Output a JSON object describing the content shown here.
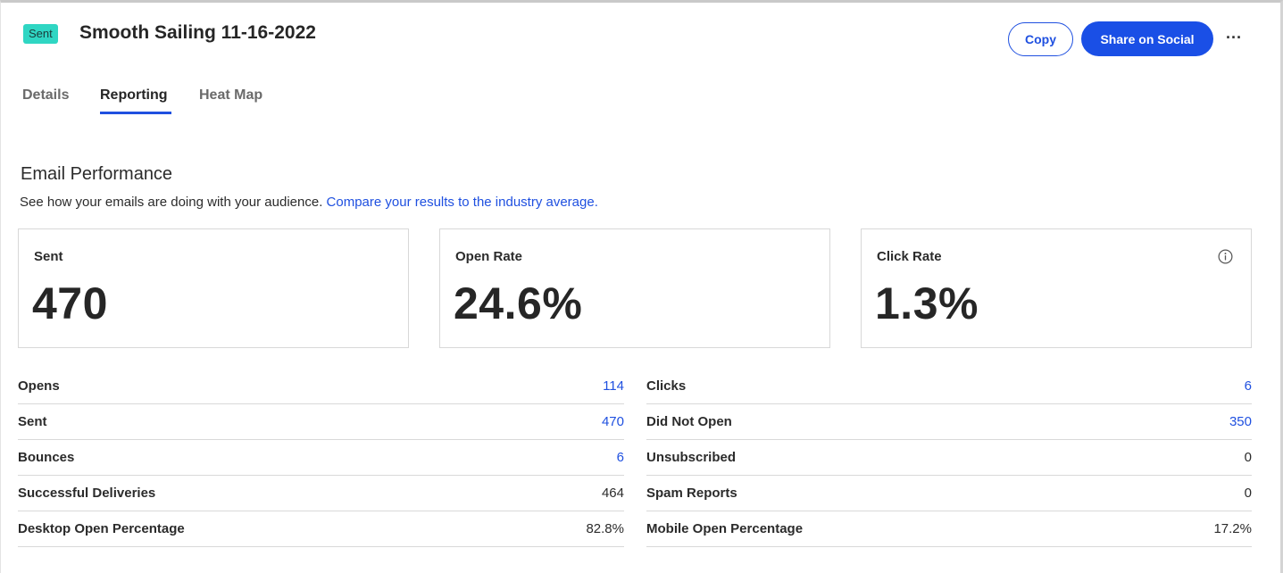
{
  "header": {
    "status_badge": "Sent",
    "title": "Smooth Sailing 11-16-2022",
    "copy_label": "Copy",
    "share_label": "Share on Social",
    "more_label": "···"
  },
  "tabs": [
    {
      "label": "Details",
      "active": false
    },
    {
      "label": "Reporting",
      "active": true
    },
    {
      "label": "Heat Map",
      "active": false
    }
  ],
  "section": {
    "title": "Email Performance",
    "subtitle": "See how your emails are doing with your audience.",
    "link": "Compare your results to the industry average."
  },
  "cards": [
    {
      "label": "Sent",
      "value": "470"
    },
    {
      "label": "Open Rate",
      "value": "24.6%"
    },
    {
      "label": "Click Rate",
      "value": "1.3%",
      "icon": "info-icon"
    }
  ],
  "metrics_left": [
    {
      "label": "Opens",
      "value": "114",
      "link": true
    },
    {
      "label": "Sent",
      "value": "470",
      "link": true
    },
    {
      "label": "Bounces",
      "value": "6",
      "link": true
    },
    {
      "label": "Successful Deliveries",
      "value": "464",
      "link": false
    },
    {
      "label": "Desktop Open Percentage",
      "value": "82.8%",
      "link": false
    }
  ],
  "metrics_right": [
    {
      "label": "Clicks",
      "value": "6",
      "link": true
    },
    {
      "label": "Did Not Open",
      "value": "350",
      "link": true
    },
    {
      "label": "Unsubscribed",
      "value": "0",
      "link": false
    },
    {
      "label": "Spam Reports",
      "value": "0",
      "link": false
    },
    {
      "label": "Mobile Open Percentage",
      "value": "17.2%",
      "link": false
    }
  ],
  "colors": {
    "badge": "#2fd6c3",
    "accent": "#1f50e0",
    "primary_button": "#1a4fe6"
  }
}
